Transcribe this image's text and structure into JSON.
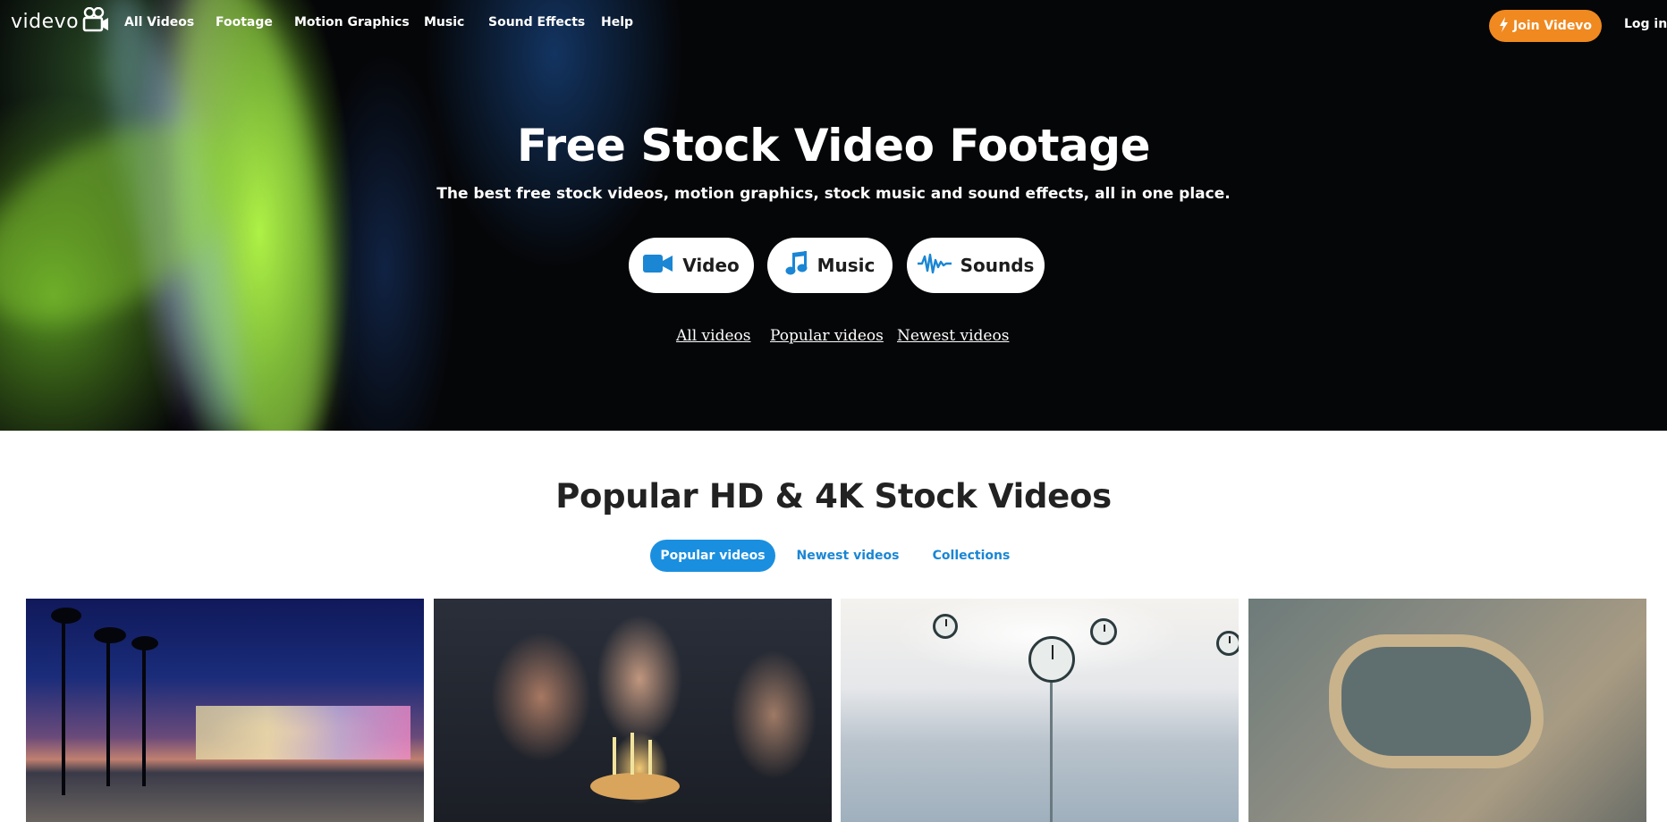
{
  "nav": {
    "logo_text": "videvo",
    "links": [
      "All Videos",
      "Footage",
      "Motion Graphics",
      "Music",
      "Sound Effects",
      "Help"
    ],
    "join_label": "Join Videvo",
    "login_label": "Log in"
  },
  "hero": {
    "title": "Free Stock Video Footage",
    "subtitle": "The best free stock videos, motion graphics, stock music and sound effects, all in one place.",
    "categories": [
      {
        "label": "Video",
        "icon": "video-camera-icon"
      },
      {
        "label": "Music",
        "icon": "music-note-icon"
      },
      {
        "label": "Sounds",
        "icon": "sound-wave-icon"
      }
    ],
    "links": [
      "All videos",
      "Popular videos",
      "Newest videos"
    ]
  },
  "popular": {
    "title": "Popular HD & 4K Stock Videos",
    "tabs": [
      "Popular videos",
      "Newest videos",
      "Collections"
    ],
    "active_tab": "Popular videos"
  },
  "colors": {
    "accent_orange": "#f0891f",
    "accent_blue": "#1a8fe0",
    "icon_blue": "#1a86d4"
  }
}
